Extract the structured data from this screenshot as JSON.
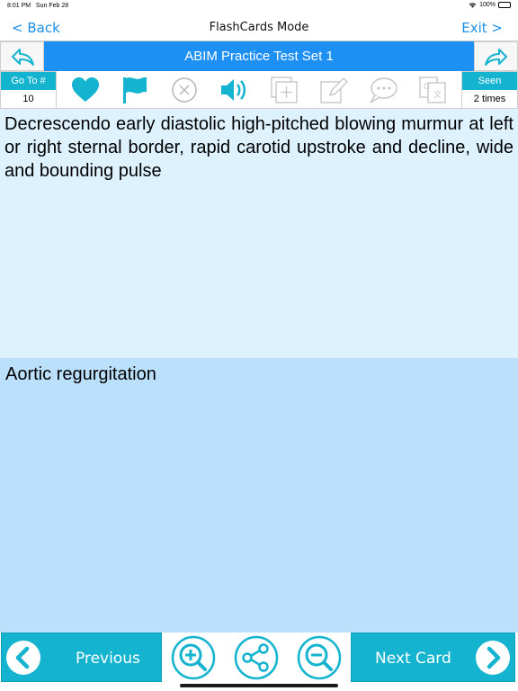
{
  "status": {
    "time": "8:01 PM",
    "date": "Sun Feb 28",
    "battery": "100%"
  },
  "nav": {
    "back_label": "< Back",
    "title": "FlashCards Mode",
    "exit_label": "Exit >"
  },
  "banner": {
    "title": "ABIM Practice Test Set 1"
  },
  "toolbar": {
    "goto_label": "Go To #",
    "goto_value": "10",
    "seen_label": "Seen",
    "seen_value": "2 times",
    "icons": [
      "heart-icon",
      "flag-icon",
      "close-circle-icon",
      "speaker-icon",
      "add-card-icon",
      "edit-icon",
      "comment-icon",
      "translate-icon"
    ]
  },
  "card": {
    "question": "Decrescendo early diastolic high-pitched blowing murmur at left or right sternal border, rapid carotid upstroke and decline, wide and bounding pulse",
    "answer": "Aortic regurgitation"
  },
  "bottom": {
    "previous_label": "Previous",
    "next_label": "Next Card"
  },
  "colors": {
    "accent": "#14b3cf",
    "banner": "#1e90f4",
    "link": "#1b8fe6",
    "question_bg": "#def2fd",
    "answer_bg": "#bbe0fc"
  }
}
